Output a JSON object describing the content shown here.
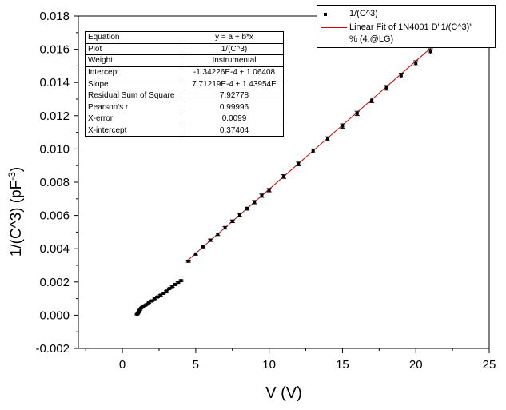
{
  "chart_data": {
    "type": "scatter",
    "xlabel": "V (V)",
    "ylabel_main": "1/(C^3) (pF",
    "ylabel_exp": "-3",
    "ylabel_close": ")",
    "xlim": [
      -3,
      25
    ],
    "ylim": [
      -0.002,
      0.018
    ],
    "xticks": [
      0,
      5,
      10,
      15,
      20,
      25
    ],
    "xtick_labels": [
      "0",
      "5",
      "10",
      "15",
      "20",
      "25"
    ],
    "yticks": [
      -0.002,
      0.0,
      0.002,
      0.004,
      0.006,
      0.008,
      0.01,
      0.012,
      0.014,
      0.016,
      0.018
    ],
    "ytick_labels": [
      "-0.002",
      "0.000",
      "0.002",
      "0.004",
      "0.006",
      "0.008",
      "0.010",
      "0.012",
      "0.014",
      "0.016",
      "0.018"
    ],
    "series": [
      {
        "name": "1/(C^3)",
        "style": "points-with-error-bars",
        "color": "#000000",
        "x": [
          1.0,
          1.05,
          1.1,
          1.15,
          1.2,
          1.3,
          1.4,
          1.5,
          1.6,
          1.8,
          2.0,
          2.2,
          2.4,
          2.6,
          2.8,
          3.0,
          3.2,
          3.4,
          3.6,
          3.8,
          4.0,
          4.5,
          5.0,
          5.5,
          6.0,
          6.5,
          7.0,
          7.5,
          8.0,
          8.5,
          9.0,
          9.5,
          10.0,
          11.0,
          12.0,
          13.0,
          14.0,
          15.0,
          16.0,
          17.0,
          18.0,
          19.0,
          20.0,
          21.0
        ],
        "y": [
          5e-05,
          0.0001,
          0.00018,
          0.00026,
          0.00033,
          0.00045,
          0.0005,
          0.00056,
          0.00062,
          0.00075,
          0.00086,
          0.00099,
          0.0011,
          0.0012,
          0.00132,
          0.00145,
          0.0016,
          0.00172,
          0.00185,
          0.00198,
          0.00208,
          0.00325,
          0.00368,
          0.00412,
          0.00451,
          0.00487,
          0.00526,
          0.00565,
          0.00603,
          0.00641,
          0.0068,
          0.00719,
          0.00752,
          0.00834,
          0.0091,
          0.00988,
          0.01061,
          0.01138,
          0.01214,
          0.01293,
          0.01368,
          0.01442,
          0.01516,
          0.01588
        ],
        "yerr": [
          3e-05,
          3e-05,
          3e-05,
          3e-05,
          3e-05,
          3e-05,
          3e-05,
          3e-05,
          3e-05,
          3e-05,
          4e-05,
          4e-05,
          4e-05,
          4e-05,
          4e-05,
          4e-05,
          4e-05,
          4e-05,
          4e-05,
          4e-05,
          5e-05,
          6e-05,
          6e-05,
          7e-05,
          7e-05,
          8e-05,
          8e-05,
          8e-05,
          9e-05,
          9e-05,
          0.0001,
          0.0001,
          0.0001,
          0.00011,
          0.00011,
          0.00012,
          0.00012,
          0.00013,
          0.00013,
          0.00014,
          0.00014,
          0.00014,
          0.00015,
          0.00015
        ]
      },
      {
        "name": "Linear Fit of 1N4001 D\"1/(C^3)\" % (4,@LG)",
        "style": "line",
        "color": "#d00000",
        "x": [
          4.5,
          21.0
        ],
        "y": [
          0.003336,
          0.016061
        ]
      }
    ],
    "legend": {
      "placement": "top-right",
      "entries": [
        "1/(C^3)",
        "Linear Fit of 1N4001 D\"1/(C^3)\"",
        "% (4,@LG)"
      ]
    },
    "fit_table": [
      [
        "Equation",
        "y = a + b*x"
      ],
      [
        "Plot",
        "1/(C^3)"
      ],
      [
        "Weight",
        "Instrumental"
      ],
      [
        "Intercept",
        "-1.34226E-4 ± 1.06408"
      ],
      [
        "Slope",
        "7.71219E-4 ± 1.43954E"
      ],
      [
        "Residual Sum of Square",
        "7.92778"
      ],
      [
        "Pearson's r",
        "0.99996"
      ],
      [
        "X-error",
        "0.0099"
      ],
      [
        "X-intercept",
        "0.37404"
      ]
    ]
  }
}
